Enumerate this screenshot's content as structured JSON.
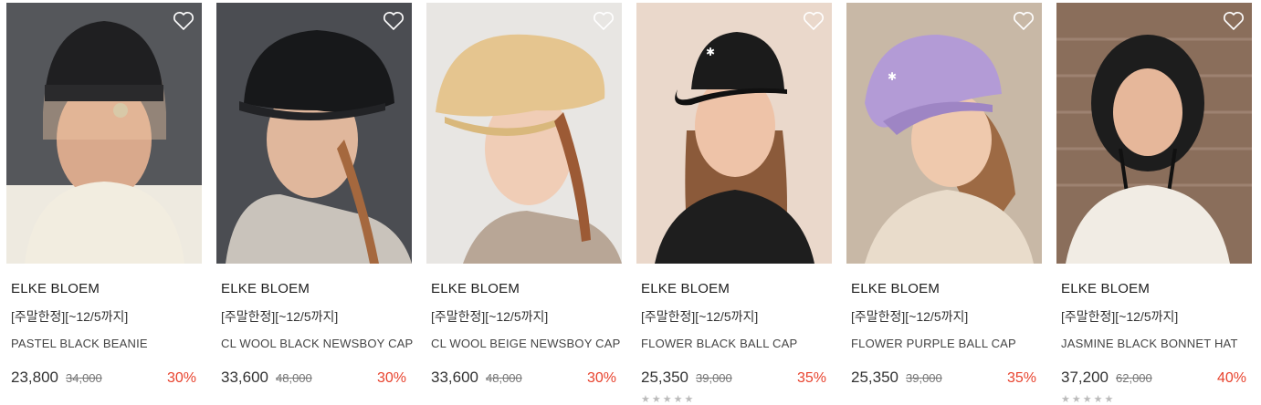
{
  "products": [
    {
      "brand": "ELKE BLOEM",
      "promo": "[주말한정][~12/5까지]",
      "name": "PASTEL BLACK BEANIE",
      "price": "23,800",
      "original_price": "34,000",
      "discount": "30%",
      "rating": "",
      "hat_color": "#222222",
      "bg": "#5a5c60"
    },
    {
      "brand": "ELKE BLOEM",
      "promo": "[주말한정][~12/5까지]",
      "name": "CL WOOL BLACK NEWSBOY CAP",
      "price": "33,600",
      "original_price": "48,000",
      "discount": "30%",
      "rating": "",
      "hat_color": "#1a1a1c",
      "bg": "#4a4c50"
    },
    {
      "brand": "ELKE BLOEM",
      "promo": "[주말한정][~12/5까지]",
      "name": "CL WOOL BEIGE NEWSBOY CAP",
      "price": "33,600",
      "original_price": "48,000",
      "discount": "30%",
      "rating": "",
      "hat_color": "#e6c993",
      "bg": "#e8e6e3"
    },
    {
      "brand": "ELKE BLOEM",
      "promo": "[주말한정][~12/5까지]",
      "name": "FLOWER BLACK BALL CAP",
      "price": "25,350",
      "original_price": "39,000",
      "discount": "35%",
      "rating": "★★★★★",
      "hat_color": "#1c1c1c",
      "bg": "#e9d7c9"
    },
    {
      "brand": "ELKE BLOEM",
      "promo": "[주말한정][~12/5까지]",
      "name": "FLOWER PURPLE BALL CAP",
      "price": "25,350",
      "original_price": "39,000",
      "discount": "35%",
      "rating": "",
      "hat_color": "#b39bd6",
      "bg": "#c9b9a7"
    },
    {
      "brand": "ELKE BLOEM",
      "promo": "[주말한정][~12/5까지]",
      "name": "JASMINE BLACK BONNET HAT",
      "price": "37,200",
      "original_price": "62,000",
      "discount": "40%",
      "rating": "★★★★★",
      "hat_color": "#1f1f1f",
      "bg": "#8b6e5a"
    }
  ],
  "icons": {
    "wishlist": "heart-outline-icon"
  },
  "colors": {
    "discount": "#e8432e",
    "text": "#222222"
  }
}
